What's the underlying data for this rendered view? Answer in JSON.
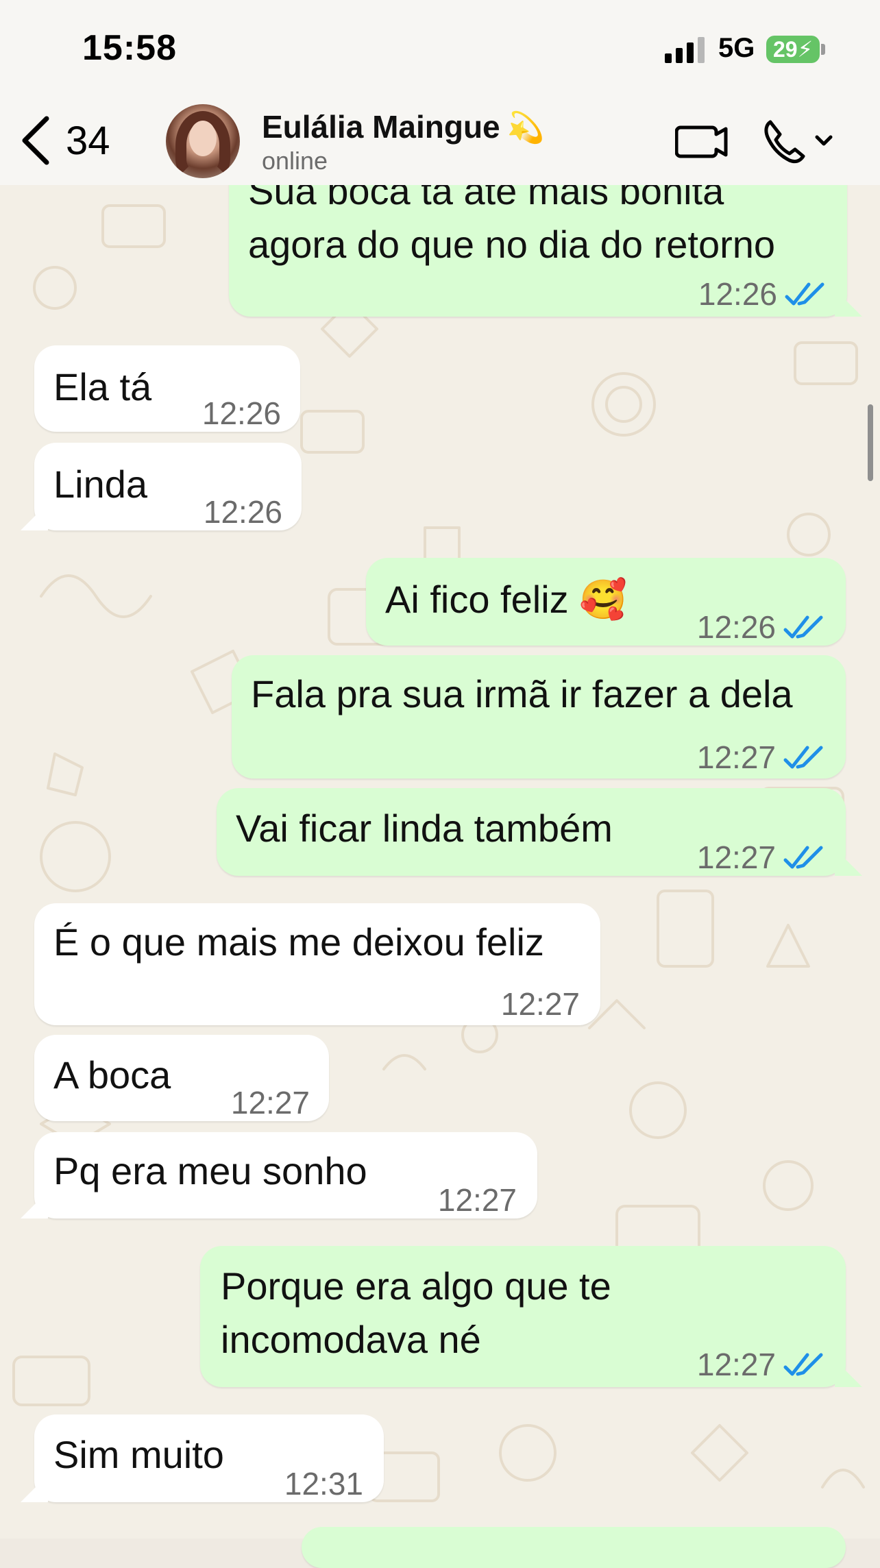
{
  "status_bar": {
    "time": "15:58",
    "network": "5G",
    "battery": "29"
  },
  "header": {
    "back_count": "34",
    "contact_name": "Eulália Maingue",
    "contact_emoji": "💫",
    "contact_status": "online"
  },
  "messages": [
    {
      "dir": "out",
      "text": "Sua boca tá até mais bonita\nagora do que no dia do retorno",
      "time": "12:26",
      "read": true
    },
    {
      "dir": "in",
      "text": "Ela tá",
      "time": "12:26"
    },
    {
      "dir": "in",
      "text": "Linda",
      "time": "12:26"
    },
    {
      "dir": "out",
      "text": "Ai fico feliz 🥰",
      "time": "12:26",
      "read": true
    },
    {
      "dir": "out",
      "text": "Fala pra sua irmã ir fazer a dela",
      "time": "12:27",
      "read": true
    },
    {
      "dir": "out",
      "text": "Vai ficar linda também",
      "time": "12:27",
      "read": true
    },
    {
      "dir": "in",
      "text": "É o que mais me deixou feliz",
      "time": "12:27"
    },
    {
      "dir": "in",
      "text": "A boca",
      "time": "12:27"
    },
    {
      "dir": "in",
      "text": "Pq era meu sonho",
      "time": "12:27"
    },
    {
      "dir": "out",
      "text": "Porque era algo que te\nincomodava né",
      "time": "12:27",
      "read": true
    },
    {
      "dir": "in",
      "text": "Sim muito",
      "time": "12:31"
    }
  ],
  "colors": {
    "outgoing_bubble": "#d9fdd3",
    "incoming_bubble": "#ffffff",
    "read_ticks": "#1f8fe8",
    "battery": "#65c466"
  },
  "icons": [
    "back-chevron-icon",
    "video-call-icon",
    "voice-call-icon",
    "chevron-down-icon",
    "read-ticks-icon"
  ]
}
